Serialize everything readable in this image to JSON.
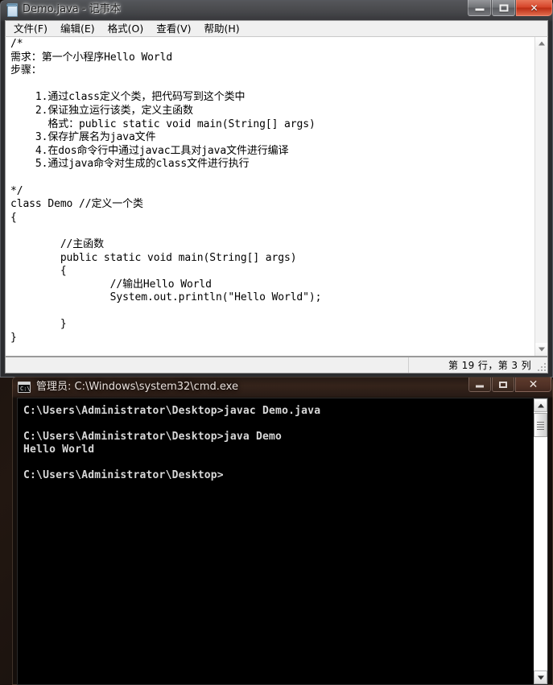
{
  "desktop": {
    "background_color": "#140f0c"
  },
  "notepad": {
    "title": "Demo.java - 记事本",
    "icon": "notepad-icon",
    "window_buttons": {
      "minimize": "minimize-icon",
      "maximize": "maximize-icon",
      "close": "✕"
    },
    "menu": [
      {
        "label": "文件(F)"
      },
      {
        "label": "编辑(E)"
      },
      {
        "label": "格式(O)"
      },
      {
        "label": "查看(V)"
      },
      {
        "label": "帮助(H)"
      }
    ],
    "editor_text": "/*\n需求：第一个小程序Hello World\n步骤：\n\n    1.通过class定义个类，把代码写到这个类中\n    2.保证独立运行该类，定义主函数\n      格式：public static void main(String[] args)\n    3.保存扩展名为java文件\n    4.在dos命令行中通过javac工具对java文件进行编译\n    5.通过java命令对生成的class文件进行执行\n\n*/\nclass Demo //定义一个类\n{\n\n        //主函数\n        public static void main(String[] args)\n        {\n                //输出Hello World\n                System.out.println(\"Hello World\");\n\n        }\n}",
    "status_bar": {
      "position_text": "第 19 行，第 3 列"
    },
    "scrollbar": {
      "up_arrow": "scroll-up-icon",
      "down_arrow": "scroll-down-icon"
    }
  },
  "cmd": {
    "title": "管理员: C:\\Windows\\system32\\cmd.exe",
    "icon": "cmd-icon",
    "icon_prompt": "C:\\",
    "window_buttons": {
      "minimize": "minimize-icon",
      "maximize": "maximize-icon",
      "close": "✕"
    },
    "console_text": "C:\\Users\\Administrator\\Desktop>javac Demo.java\n\nC:\\Users\\Administrator\\Desktop>java Demo\nHello World\n\nC:\\Users\\Administrator\\Desktop>",
    "scrollbar": {
      "up_arrow": "scroll-up-icon",
      "down_arrow": "scroll-down-icon",
      "thumb": "scroll-thumb"
    }
  }
}
